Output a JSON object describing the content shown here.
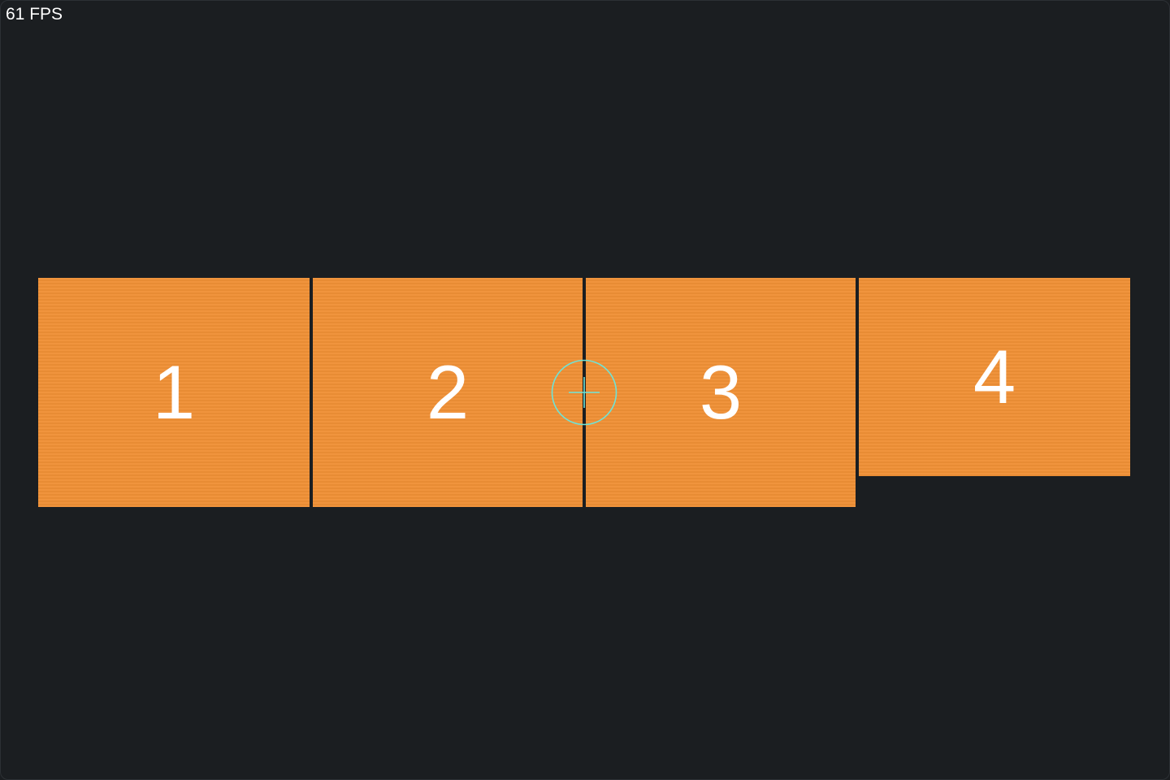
{
  "overlay": {
    "fps_text": "61 FPS"
  },
  "tiles": [
    {
      "label": "1"
    },
    {
      "label": "2"
    },
    {
      "label": "3"
    },
    {
      "label": "4"
    }
  ],
  "colors": {
    "background": "#1b1e21",
    "tile": "#f09036",
    "tile_text": "#ffffff",
    "cursor": "#6fe3d6"
  },
  "cursor": {
    "icon": "crosshair-circle-icon"
  }
}
